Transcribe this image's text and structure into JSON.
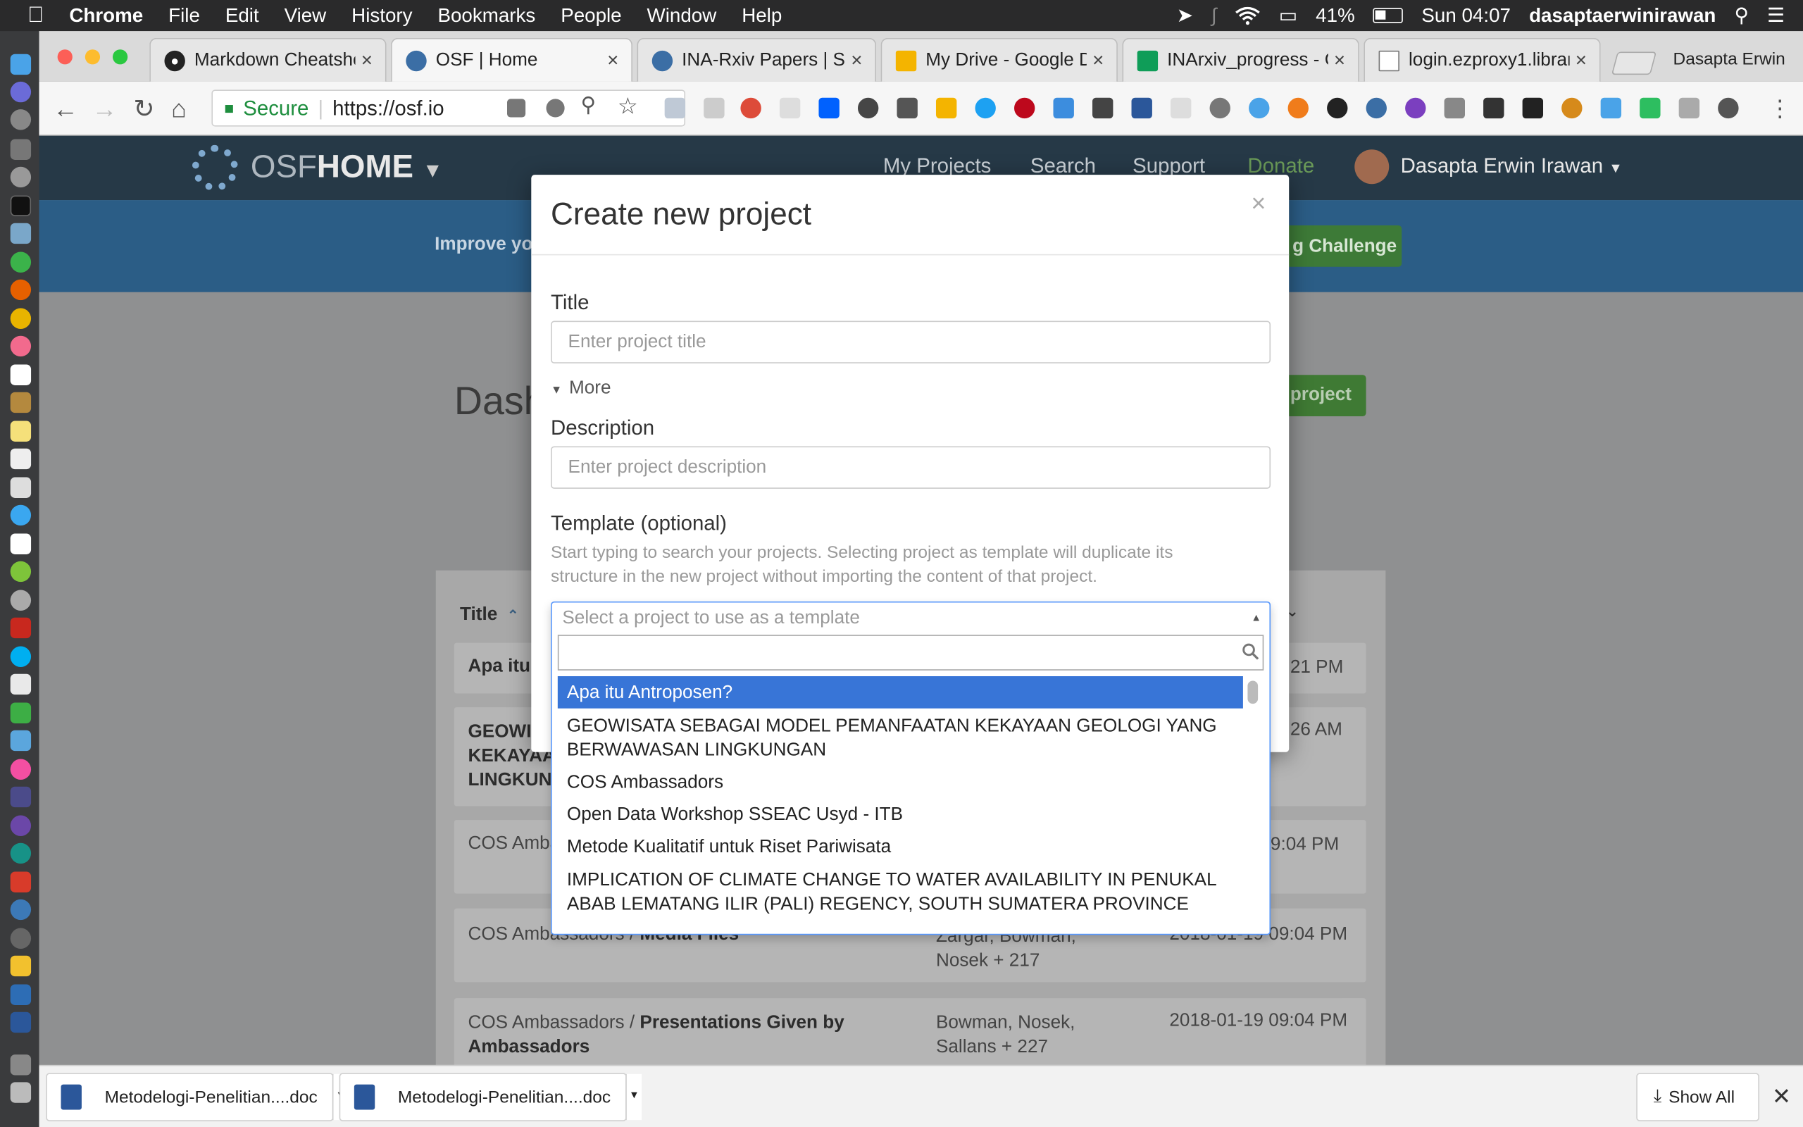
{
  "menubar": {
    "app": "Chrome",
    "items": [
      "File",
      "Edit",
      "View",
      "History",
      "Bookmarks",
      "People",
      "Window",
      "Help"
    ],
    "battery": "41%",
    "clock": "Sun 04:07",
    "user": "dasaptaerwinirawan"
  },
  "tabs": [
    {
      "title": "Markdown Cheatshe",
      "close": "×"
    },
    {
      "title": "OSF | Home",
      "close": "×"
    },
    {
      "title": "INA-Rxiv Papers | Se",
      "close": "×"
    },
    {
      "title": "My Drive - Google D",
      "close": "×"
    },
    {
      "title": "INArxiv_progress - G",
      "close": "×"
    },
    {
      "title": "login.ezproxy1.library",
      "close": "×"
    }
  ],
  "profile_name": "Dasapta Erwin",
  "address": {
    "secure": "Secure",
    "url": "https://osf.io"
  },
  "osf": {
    "brand_light": "OSF",
    "brand_bold": "HOME",
    "nav": [
      "My Projects",
      "Search",
      "Support",
      "Donate"
    ],
    "user": "Dasapta Erwin Irawan",
    "banner_left": "Improve yo",
    "banner_right": "g Challenge",
    "dash": "Dash",
    "create_btn": "project",
    "col_title": "Title"
  },
  "rows": [
    {
      "title": "Apa itu",
      "date": "21 PM",
      "contrib": ""
    },
    {
      "title": "GEOWIS\nKEKAYAA\nLINGKUN",
      "date": "26 AM",
      "contrib": ""
    },
    {
      "title": "COS Amba",
      "date": "09:04 PM",
      "contrib": ""
    },
    {
      "prefix": "COS Ambassadors / ",
      "title": "Media Files",
      "contrib": "Zargar, Bowman,\nNosek + 217",
      "date": "2018-01-19 09:04 PM"
    },
    {
      "prefix": "COS Ambassadors / ",
      "title": "Presentations Given by\nAmbassadors",
      "contrib": "Bowman, Nosek,\nSallans + 227",
      "date": "2018-01-19 09:04 PM"
    }
  ],
  "modal": {
    "title": "Create new project",
    "close": "×",
    "title_label": "Title",
    "title_placeholder": "Enter project title",
    "more": "More",
    "desc_label": "Description",
    "desc_placeholder": "Enter project description",
    "template_label": "Template (optional)",
    "template_help": "Start typing to search your projects. Selecting project as template will duplicate its structure in the new project without importing the content of that project.",
    "select_placeholder": "Select a project to use as a template"
  },
  "options": [
    "Apa itu Antroposen?",
    "GEOWISATA SEBAGAI MODEL PEMANFAATAN KEKAYAAN GEOLOGI YANG BERWAWASAN LINGKUNGAN",
    "COS Ambassadors",
    "Open Data Workshop SSEAC Usyd - ITB",
    "Metode Kualitatif untuk Riset Pariwisata",
    "IMPLICATION OF CLIMATE CHANGE TO WATER AVAILABILITY IN PENUKAL ABAB LEMATANG ILIR (PALI) REGENCY, SOUTH SUMATERA PROVINCE"
  ],
  "downloads": [
    {
      "name": "Metodelogi-Penelitian....doc"
    },
    {
      "name": "Metodelogi-Penelitian....doc"
    }
  ],
  "show_all": "Show All",
  "colors": {
    "osf_nav": "#263947",
    "highlight": "#3875d7",
    "green": "#4f8a3c"
  }
}
